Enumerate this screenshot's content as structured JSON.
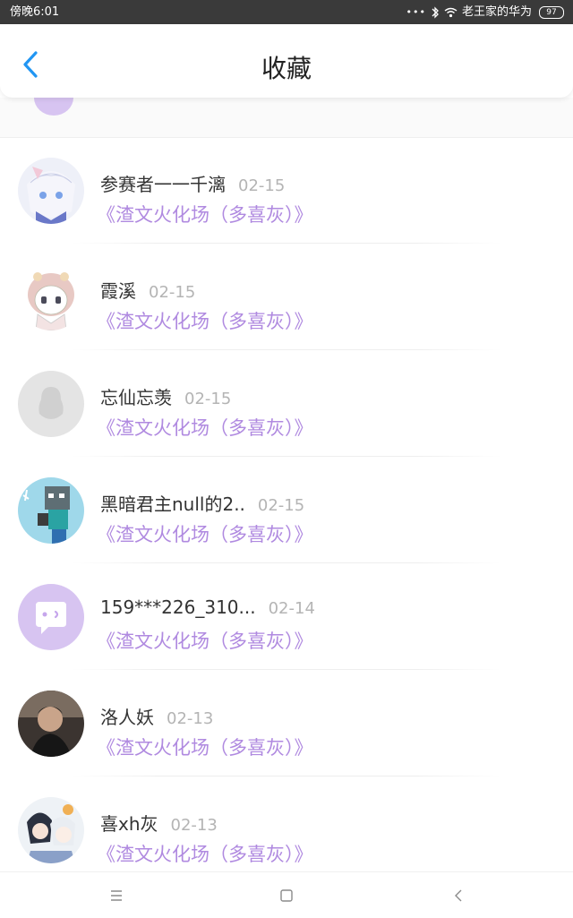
{
  "status_bar": {
    "time": "傍晚6:01",
    "dots": "•••",
    "carrier": "老王家的华为",
    "battery": "97"
  },
  "header": {
    "title": "收藏"
  },
  "favorites": [
    {
      "name": "参赛者一一千漓",
      "date": "02-15",
      "subtitle": "《渣文火化场（多喜灰）》",
      "avatar": "anime-character-avatar"
    },
    {
      "name": "霞溪",
      "date": "02-15",
      "subtitle": "《渣文火化场（多喜灰）》",
      "avatar": "chibi-character-avatar"
    },
    {
      "name": "忘仙忘羡",
      "date": "02-15",
      "subtitle": "《渣文火化场（多喜灰）》",
      "avatar": "default-penguin-avatar"
    },
    {
      "name": "黑暗君主null的2..",
      "date": "02-15",
      "subtitle": "《渣文火化场（多喜灰）》",
      "avatar": "pixel-character-avatar"
    },
    {
      "name": "159***226_310...",
      "date": "02-14",
      "subtitle": "《渣文火化场（多喜灰）》",
      "avatar": "purple-chat-avatar"
    },
    {
      "name": "洛人妖",
      "date": "02-13",
      "subtitle": "《渣文火化场（多喜灰）》",
      "avatar": "photo-portrait-avatar"
    },
    {
      "name": "喜xh灰",
      "date": "02-13",
      "subtitle": "《渣文火化场（多喜灰）》",
      "avatar": "anime-duo-avatar"
    }
  ],
  "colors": {
    "accent_blue": "#2196f3",
    "subtitle_purple": "#b08ae0",
    "avatar_purple": "#d7c4f1"
  }
}
